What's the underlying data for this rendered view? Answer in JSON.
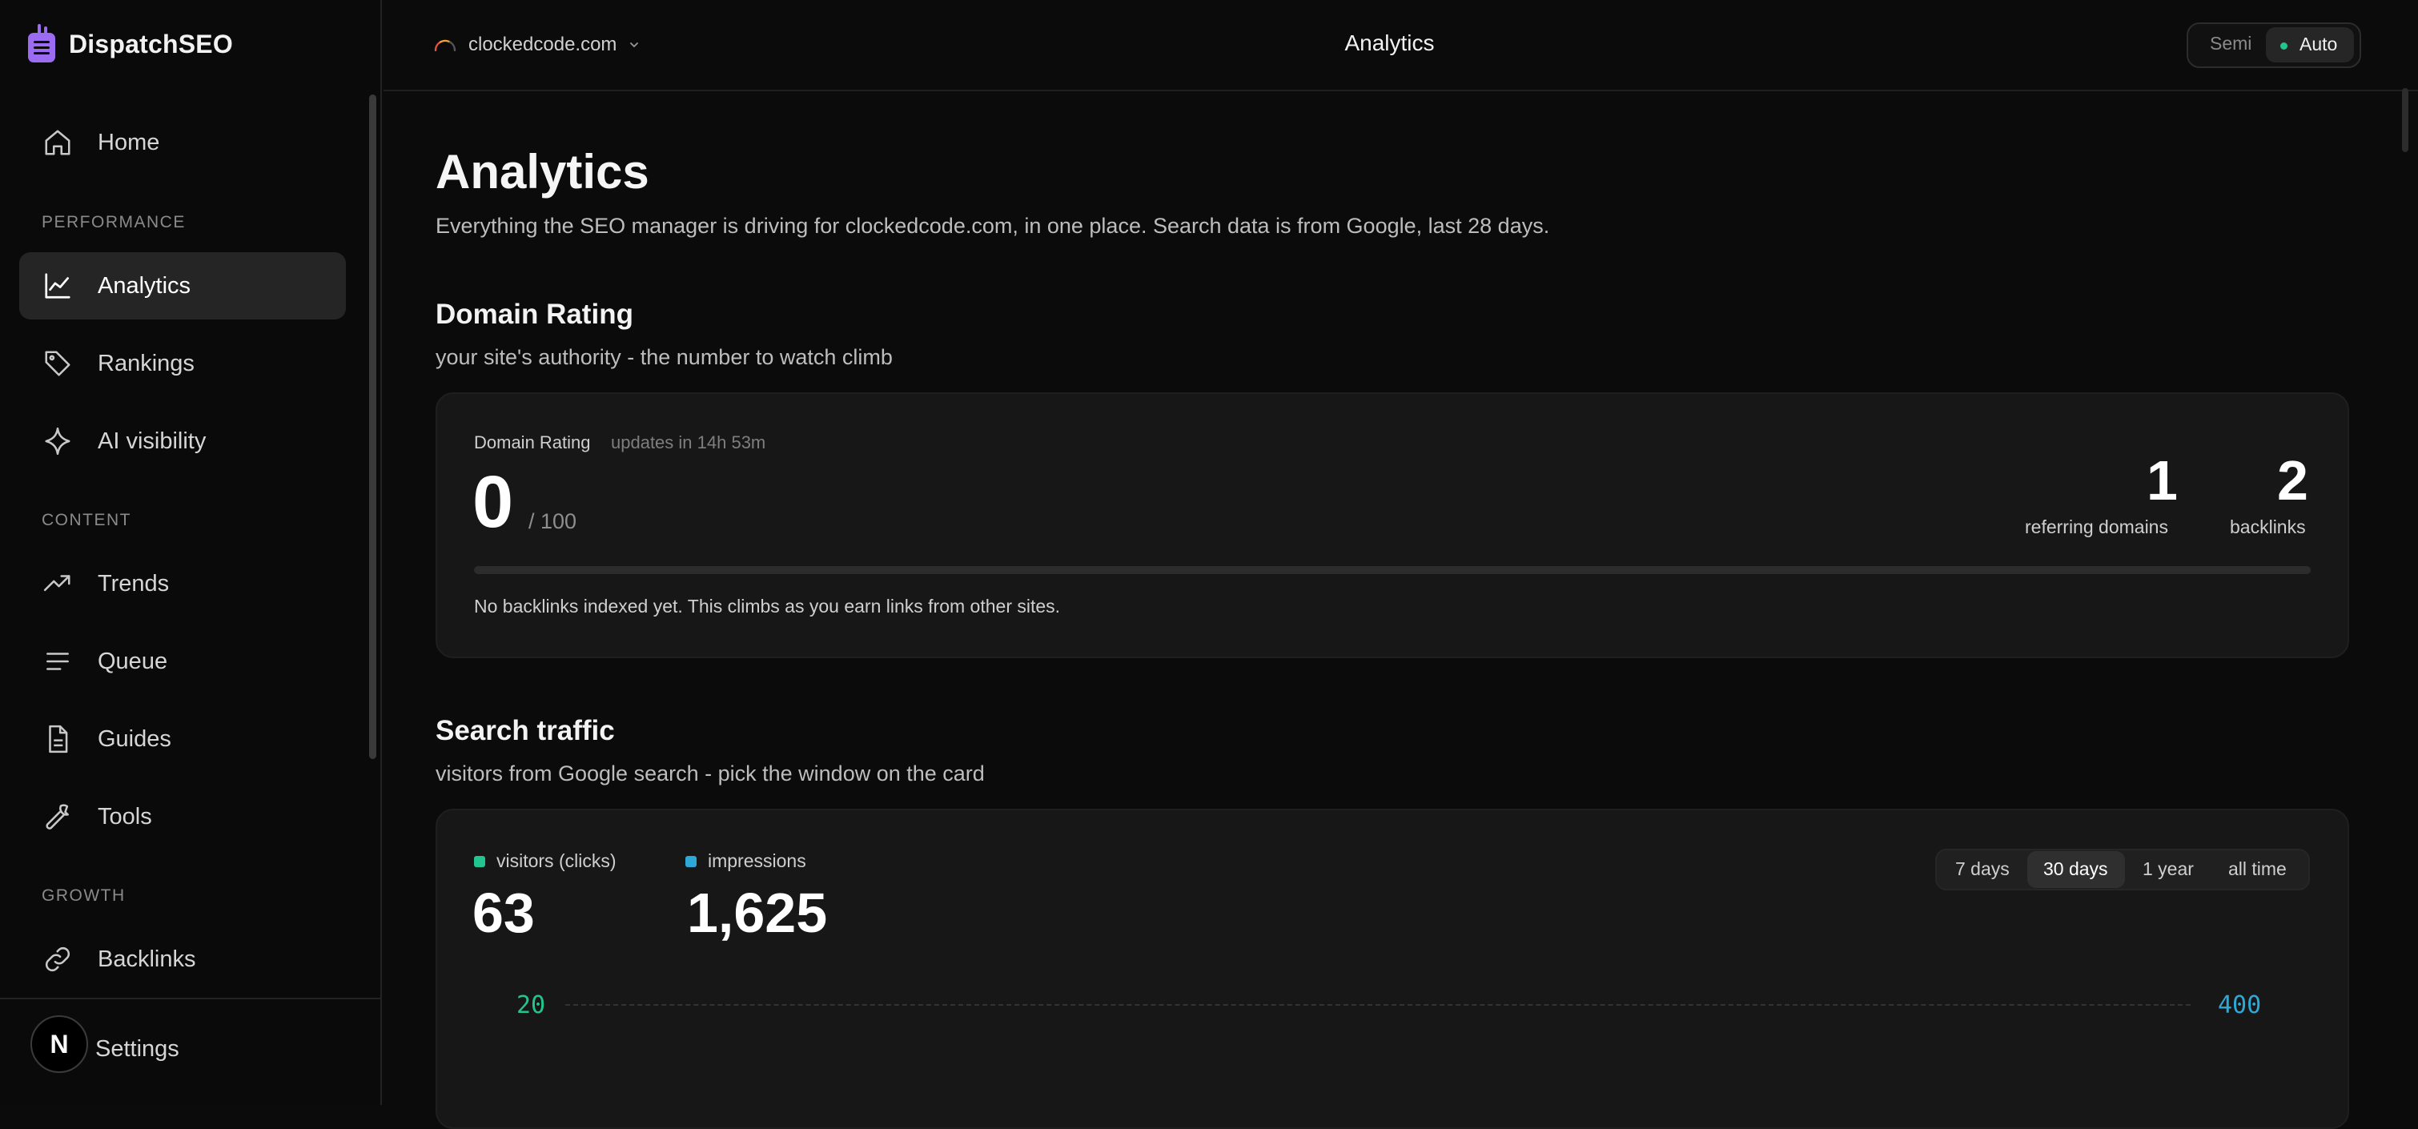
{
  "brand": {
    "name": "DispatchSEO"
  },
  "sidebar": {
    "items": [
      {
        "label": "Home",
        "icon": "home-icon"
      },
      {
        "label": "Analytics",
        "icon": "line-chart-icon",
        "active": true
      },
      {
        "label": "Rankings",
        "icon": "tag-icon"
      },
      {
        "label": "AI visibility",
        "icon": "sparkle-icon"
      },
      {
        "label": "Trends",
        "icon": "trending-up-icon"
      },
      {
        "label": "Queue",
        "icon": "list-icon"
      },
      {
        "label": "Guides",
        "icon": "document-icon"
      },
      {
        "label": "Tools",
        "icon": "wrench-icon"
      },
      {
        "label": "Backlinks",
        "icon": "link-icon"
      }
    ],
    "sections": [
      "PERFORMANCE",
      "CONTENT",
      "GROWTH"
    ],
    "footer": {
      "avatar_letter": "N",
      "settings_label": "Settings"
    }
  },
  "topbar": {
    "site": "clockedcode.com",
    "title": "Analytics",
    "mode": {
      "semi": "Semi",
      "auto": "Auto",
      "selected": "Auto"
    }
  },
  "page": {
    "title": "Analytics",
    "lead": "Everything the SEO manager is driving for clockedcode.com, in one place. Search data is from Google, last 28 days."
  },
  "domain_rating": {
    "heading": "Domain Rating",
    "subheading": "your site's authority - the number to watch climb",
    "card_label": "Domain Rating",
    "updates": "updates in 14h 53m",
    "value": "0",
    "max": "/ 100",
    "progress": 0,
    "referring_domains": {
      "value": "1",
      "label": "referring domains"
    },
    "backlinks": {
      "value": "2",
      "label": "backlinks"
    },
    "note": "No backlinks indexed yet. This climbs as you earn links from other sites."
  },
  "search_traffic": {
    "heading": "Search traffic",
    "subheading": "visitors from Google search - pick the window on the card",
    "clicks": {
      "label": "visitors (clicks)",
      "value": "63",
      "color": "#22c58f"
    },
    "impressions": {
      "label": "impressions",
      "value": "1,625",
      "color": "#2ea8d6"
    },
    "ranges": [
      "7 days",
      "30 days",
      "1 year",
      "all time"
    ],
    "selected_range": "30 days",
    "axis_left_top": "20",
    "axis_right_top": "400"
  },
  "colors": {
    "accent_green": "#22c58f",
    "accent_blue": "#2ea8d6",
    "brand_purple": "#9b6bf2"
  }
}
